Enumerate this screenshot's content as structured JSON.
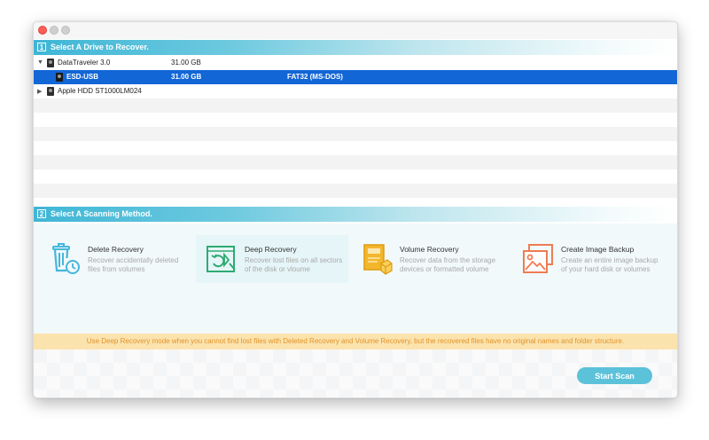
{
  "section1": {
    "number": "1",
    "title": "Select A Drive to Recover."
  },
  "drives": [
    {
      "name": "DataTraveler 3.0",
      "size": "31.00 GB",
      "filesystem": "",
      "expanded": true
    },
    {
      "name": "ESD-USB",
      "size": "31.00 GB",
      "filesystem": "FAT32 (MS-DOS)",
      "selected": true
    },
    {
      "name": "Apple HDD ST1000LM024",
      "size": "",
      "filesystem": "",
      "expanded": false
    }
  ],
  "section2": {
    "number": "2",
    "title": "Select A Scanning Method."
  },
  "methods": [
    {
      "title": "Delete Recovery",
      "desc": "Recover accidentally deleted files from volumes",
      "icon": "trash-clock-icon",
      "color": "#45b6dc"
    },
    {
      "title": "Deep Recovery",
      "desc": "Recover lost files on all sectors of the disk or vloume",
      "icon": "disk-recovery-icon",
      "color": "#2eab72",
      "active": true
    },
    {
      "title": "Volume Recovery",
      "desc": "Recover data from the storage devices or formatted volume",
      "icon": "volume-box-icon",
      "color": "#f3b72c"
    },
    {
      "title": "Create Image Backup",
      "desc": "Create an entire image backup of your hard disk or volumes",
      "icon": "image-backup-icon",
      "color": "#ee7c52"
    }
  ],
  "notice": "Use Deep Recovery mode when you cannot find lost files with Deleted Recovery and Volume Recovery, but the recovered files have no original names and folder structure.",
  "start_scan_label": "Start Scan",
  "colors": {
    "accent": "#5cc2d9",
    "selection": "#1266d6",
    "notice_bg": "#fbe3ae",
    "notice_text": "#e39328"
  }
}
